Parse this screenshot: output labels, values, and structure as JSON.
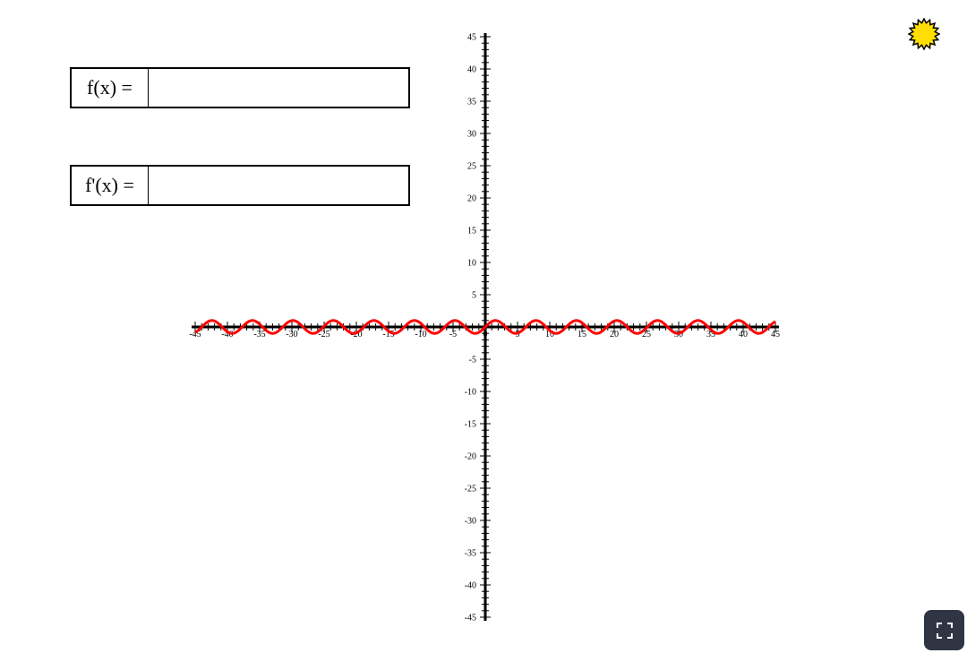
{
  "inputs": {
    "f_label": "f(x) =",
    "f_value": "",
    "fprime_label": "f'(x) =",
    "fprime_value": ""
  },
  "icons": {
    "theme": "sun-icon",
    "fullscreen": "fullscreen-icon"
  },
  "colors": {
    "curve": "#ff0000",
    "axis": "#000000",
    "sun_fill": "#ffde00",
    "button_bg": "#2f3542"
  },
  "chart_data": {
    "type": "line",
    "xlim": [
      -45,
      45
    ],
    "ylim": [
      -45,
      45
    ],
    "x_ticks": [
      -45,
      -40,
      -35,
      -30,
      -25,
      -20,
      -15,
      -10,
      -5,
      0,
      5,
      10,
      15,
      20,
      25,
      30,
      35,
      40,
      45
    ],
    "y_ticks": [
      45,
      40,
      35,
      30,
      25,
      20,
      15,
      10,
      5,
      -5,
      -10,
      -15,
      -20,
      -25,
      -30,
      -35,
      -40,
      -45
    ],
    "grid": false,
    "series": [
      {
        "function": "sin(x)",
        "x_range": [
          -45,
          45
        ],
        "color": "#ff0000"
      }
    ]
  }
}
